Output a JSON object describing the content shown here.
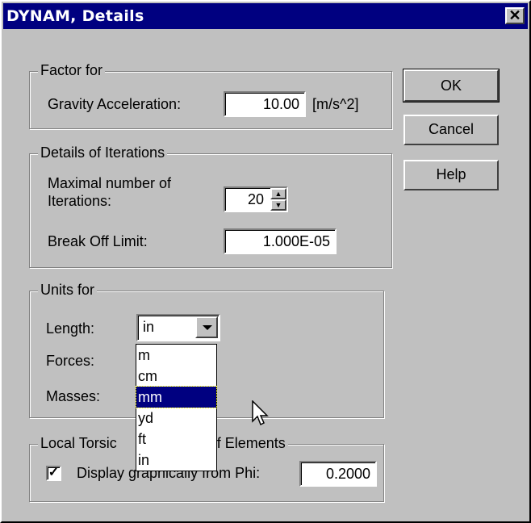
{
  "window": {
    "title": "DYNAM, Details",
    "close_glyph": "✕"
  },
  "factor_group": {
    "legend": "Factor for",
    "gravity_label": "Gravity Acceleration:",
    "gravity_value": "10.00",
    "gravity_unit": "[m/s^2]"
  },
  "iterations_group": {
    "legend": "Details of Iterations",
    "max_label_line1": "Maximal number of",
    "max_label_line2": "Iterations:",
    "max_value": "20",
    "break_label": "Break Off Limit:",
    "break_value": "1.000E-05"
  },
  "units_group": {
    "legend": "Units for",
    "length_label": "Length:",
    "length_value": "in",
    "forces_label": "Forces:",
    "masses_label": "Masses:",
    "dropdown_options": [
      "m",
      "cm",
      "mm",
      "yd",
      "ft",
      "in"
    ],
    "highlighted_option": "mm"
  },
  "torsion_group": {
    "legend_left": "Local Torsic",
    "legend_right": "s of Elements",
    "checkbox_checked": true,
    "checkbox_left": "Display graphically",
    "checkbox_right": " from Phi:",
    "phi_value": "0.2000"
  },
  "buttons": {
    "ok": "OK",
    "cancel": "Cancel",
    "help": "Help"
  },
  "icons": {
    "checkmark": "check-icon",
    "close": "close-icon",
    "cursor": "mouse-pointer-icon"
  }
}
